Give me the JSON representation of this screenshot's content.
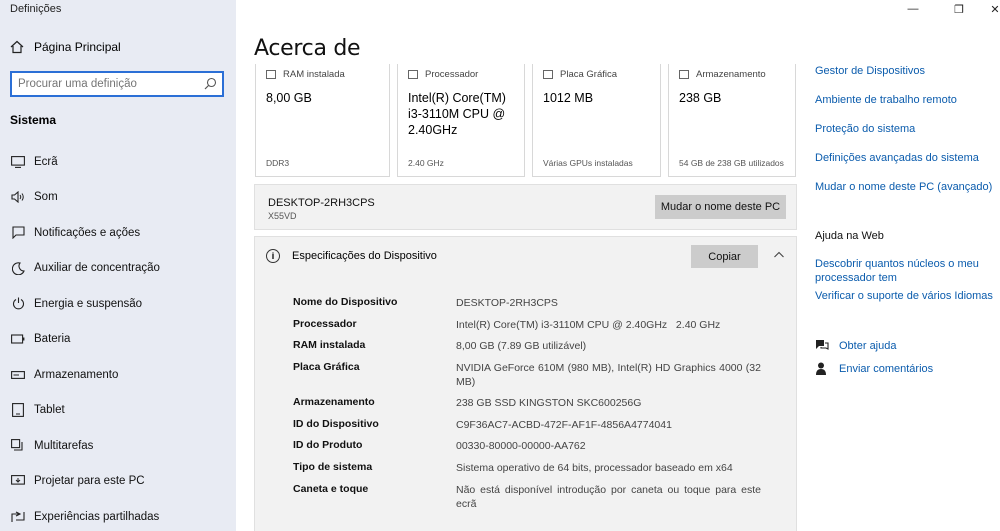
{
  "window": {
    "app_title": "Definições",
    "controls": {
      "minimize": "—",
      "restore": "❐",
      "close": "✕"
    }
  },
  "sidebar": {
    "home_label": "Página Principal",
    "search_placeholder": "Procurar uma definição",
    "section_title": "Sistema",
    "items": [
      {
        "label": "Ecrã",
        "icon": "display-icon"
      },
      {
        "label": "Som",
        "icon": "speaker-icon"
      },
      {
        "label": "Notificações e ações",
        "icon": "notification-icon"
      },
      {
        "label": "Auxiliar de concentração",
        "icon": "moon-icon"
      },
      {
        "label": "Energia e suspensão",
        "icon": "power-icon"
      },
      {
        "label": "Bateria",
        "icon": "battery-icon"
      },
      {
        "label": "Armazenamento",
        "icon": "storage-icon"
      },
      {
        "label": "Tablet",
        "icon": "tablet-icon"
      },
      {
        "label": "Multitarefas",
        "icon": "multitask-icon"
      },
      {
        "label": "Projetar para este PC",
        "icon": "project-icon"
      },
      {
        "label": "Experiências partilhadas",
        "icon": "shared-icon"
      }
    ]
  },
  "main": {
    "title": "Acerca de",
    "cards": [
      {
        "label": "RAM instalada",
        "value": "8,00 GB",
        "foot": "DDR3"
      },
      {
        "label": "Processador",
        "value": "Intel(R) Core(TM) i3-3110M CPU @ 2.40GHz",
        "foot": "2.40 GHz"
      },
      {
        "label": "Placa Gráfica",
        "value": "1012 MB",
        "foot": "Várias GPUs instaladas"
      },
      {
        "label": "Armazenamento",
        "value": "238 GB",
        "foot": "54 GB de 238 GB utilizados"
      }
    ],
    "device": {
      "name": "DESKTOP-2RH3CPS",
      "model": "X55VD",
      "rename_button": "Mudar o nome deste PC"
    },
    "specs": {
      "title": "Especificações do Dispositivo",
      "copy_button": "Copiar",
      "rows": [
        {
          "key": "Nome do Dispositivo",
          "value": "DESKTOP-2RH3CPS"
        },
        {
          "key": "Processador",
          "value": "Intel(R) Core(TM) i3-3110M CPU @ 2.40GHz   2.40 GHz"
        },
        {
          "key": "RAM instalada",
          "value": "8,00 GB (7.89 GB utilizável)"
        },
        {
          "key": "Placa Gráfica",
          "value": "NVIDIA GeForce 610M (980 MB), Intel(R) HD Graphics 4000 (32 MB)"
        },
        {
          "key": "Armazenamento",
          "value": "238 GB SSD KINGSTON SKC600256G"
        },
        {
          "key": "ID do Dispositivo",
          "value": "C9F36AC7-ACBD-472F-AF1F-4856A4774041"
        },
        {
          "key": "ID do Produto",
          "value": "00330-80000-00000-AA762"
        },
        {
          "key": "Tipo de sistema",
          "value": "Sistema operativo de 64 bits, processador baseado em x64"
        },
        {
          "key": "Caneta e toque",
          "value": "Não está disponível introdução por caneta ou toque para este ecrã"
        }
      ]
    }
  },
  "right_panel": {
    "links": [
      "Gestor de Dispositivos",
      "Ambiente de trabalho remoto",
      "Proteção do sistema",
      "Definições avançadas do sistema",
      "Mudar o nome deste PC (avançado)"
    ],
    "web_title": "Ajuda na Web",
    "web_links": [
      "Descobrir quantos núcleos o meu processador tem",
      "Verificar o suporte de vários Idiomas"
    ],
    "help": {
      "get_help": "Obter ajuda",
      "feedback": "Enviar comentários"
    }
  },
  "colors": {
    "accent": "#2b6fd6",
    "link": "#0b5cad",
    "sidebar_bg": "#e8ebf3",
    "panel_bg": "#f2f2f2",
    "button_bg": "#cccccc"
  }
}
